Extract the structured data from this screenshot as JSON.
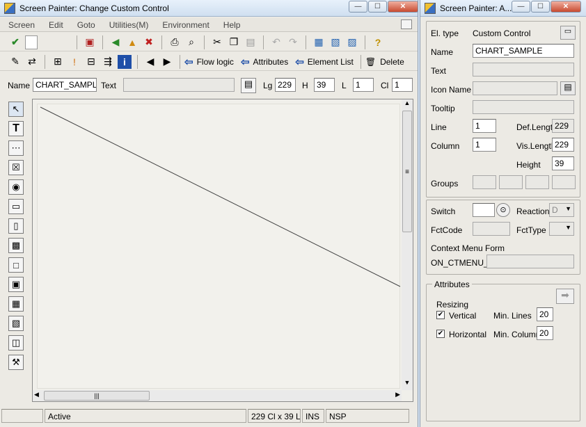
{
  "main_window": {
    "title": "Screen Painter:  Change Custom Control",
    "menu": [
      "Screen",
      "Edit",
      "Goto",
      "Utilities(M)",
      "Environment",
      "Help"
    ],
    "toolbar2": {
      "flow_logic": "Flow logic",
      "attributes": "Attributes",
      "element_list": "Element List",
      "delete": "Delete"
    },
    "fieldbar": {
      "name_label": "Name",
      "name_value": "CHART_SAMPLE",
      "text_label": "Text",
      "text_value": "",
      "lg_label": "Lg",
      "lg_value": "229",
      "h_label": "H",
      "h_value": "39",
      "l_label": "L",
      "l_value": "1",
      "cl_label": "Cl",
      "cl_value": "1"
    },
    "status": {
      "state": "Active",
      "size": "229 Cl x 39 L",
      "mode": "INS",
      "nsp": "NSP"
    }
  },
  "attr_window": {
    "title": "Screen Painter: A...",
    "el_type_label": "El. type",
    "el_type_value": "Custom Control",
    "name_label": "Name",
    "name_value": "CHART_SAMPLE",
    "text_label": "Text",
    "text_value": "",
    "icon_name_label": "Icon Name",
    "icon_name_value": "",
    "tooltip_label": "Tooltip",
    "tooltip_value": "",
    "line_label": "Line",
    "line_value": "1",
    "column_label": "Column",
    "column_value": "1",
    "def_length_label": "Def.Lengt",
    "def_length_value": "229",
    "vis_length_label": "Vis.Length",
    "vis_length_value": "229",
    "height_label": "Height",
    "height_value": "39",
    "groups_label": "Groups",
    "switch_label": "Switch",
    "switch_value": "",
    "reaction_label": "Reaction",
    "reaction_value": "D",
    "fctcode_label": "FctCode",
    "fctcode_value": "",
    "fcttype_label": "FctType",
    "fcttype_value": "",
    "context_menu_label": "Context Menu Form",
    "context_menu_prefix": "ON_CTMENU_",
    "context_menu_value": "",
    "attributes_group": "Attributes",
    "resizing_label": "Resizing",
    "vertical_label": "Vertical",
    "vertical_checked": "✔",
    "min_lines_label": "Min. Lines",
    "min_lines_value": "20",
    "horizontal_label": "Horizontal",
    "horizontal_checked": "✔",
    "min_columns_label": "Min. Columns",
    "min_columns_value": "20"
  }
}
